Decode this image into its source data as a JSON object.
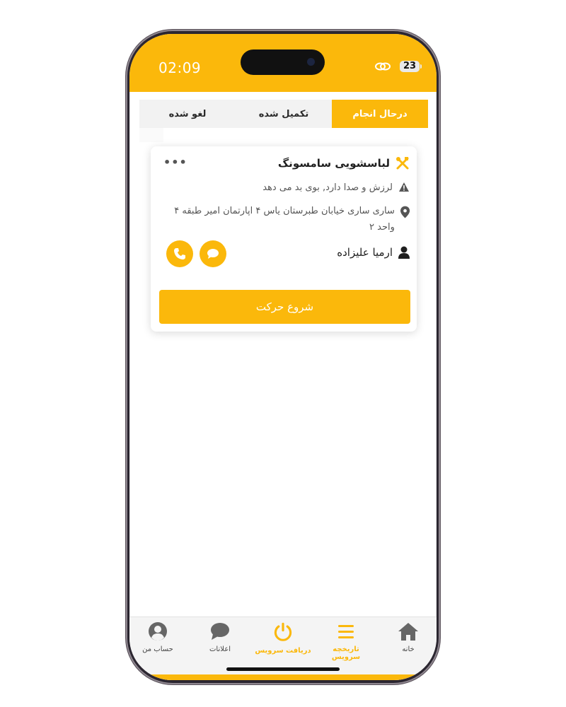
{
  "status_bar": {
    "time": "02:09",
    "battery": "23",
    "icons": [
      "link-icon",
      "battery-icon"
    ]
  },
  "tabs": [
    {
      "label": "درحال انجام",
      "active": true
    },
    {
      "label": "تکمیل شده",
      "active": false
    },
    {
      "label": "لغو شده",
      "active": false
    }
  ],
  "card": {
    "title": "لباسشویی سامسونگ",
    "title_icon": "tools-icon",
    "more_icon": "more-icon",
    "issue": "لرزش و صدا دارد, بوی بد می دهد",
    "address": "ساری ساری خیابان طبرستان یاس ۴ اپارتمان امیر طبقه ۴ واحد ۲",
    "customer_name": "ارمیا علیزاده",
    "start_button_label": "شروع حرکت"
  },
  "bottom_nav": [
    {
      "label": "خانه",
      "icon": "home-icon",
      "active": false
    },
    {
      "label": "تاریخچه سرویس",
      "icon": "menu-icon",
      "active": true
    },
    {
      "label": "دریافت سرویس",
      "icon": "power-icon",
      "active": true
    },
    {
      "label": "اعلانات",
      "icon": "chat-icon",
      "active": false
    },
    {
      "label": "حساب من",
      "icon": "user-circle-icon",
      "active": false
    }
  ],
  "colors": {
    "accent": "#fbb80b",
    "text_dark": "#1f1f1f",
    "text_muted": "#555555"
  }
}
